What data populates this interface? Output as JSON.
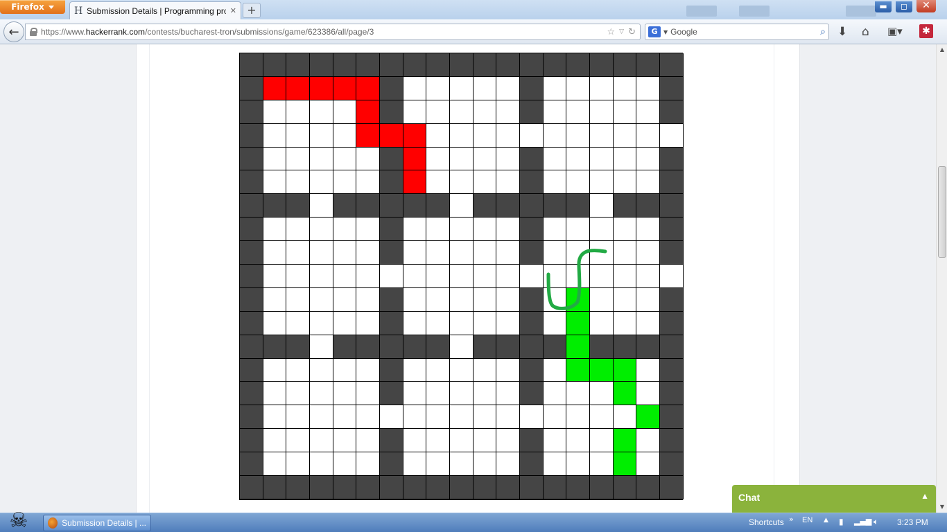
{
  "browser": {
    "menu_button": "Firefox",
    "tab_title": "Submission Details | Programming probl...",
    "new_tab": "+",
    "url_prefix": "https://www.",
    "url_domain": "hackerrank.com",
    "url_path": "/contests/bucharest-tron/submissions/game/623386/all/page/3",
    "search_engine_icon": "G",
    "search_placeholder": "Google"
  },
  "game": {
    "board_rows": [
      "WWWWWWWWWWWWWWWWWWW",
      "WRRRRRW.....W.....W",
      "W....RW.....W.....W",
      "W....RRR...........W",
      "W.....WR....W.....W",
      "W.....WR....W.....W",
      "WWW.WWWWW.WWWWW.WWW",
      "W.....W.....W.....W",
      "W.....W.....W.....W",
      "W...................W",
      "W.....W.....W.G...W",
      "W.....W.....W.G...W",
      "WWW.WWWWW.WWWWGWWWW",
      "W.....W.....W.GGG.W",
      "W.....W.....W...G.W",
      "W................GW",
      "W.....W.....W...G.W",
      "W.....W.....W...G.W",
      "WWWWWWWWWWWWWWWWWWW"
    ],
    "colors": {
      "wall": "#454545",
      "empty": "#ffffff",
      "player1": "#ff0000",
      "player2": "#00ee00",
      "annotation": "#22aa44"
    }
  },
  "chat": {
    "label": "Chat"
  },
  "taskbar": {
    "task_label": "Submission Details | ...",
    "shortcuts": "Shortcuts",
    "language": "EN",
    "clock": "3:23 PM"
  }
}
